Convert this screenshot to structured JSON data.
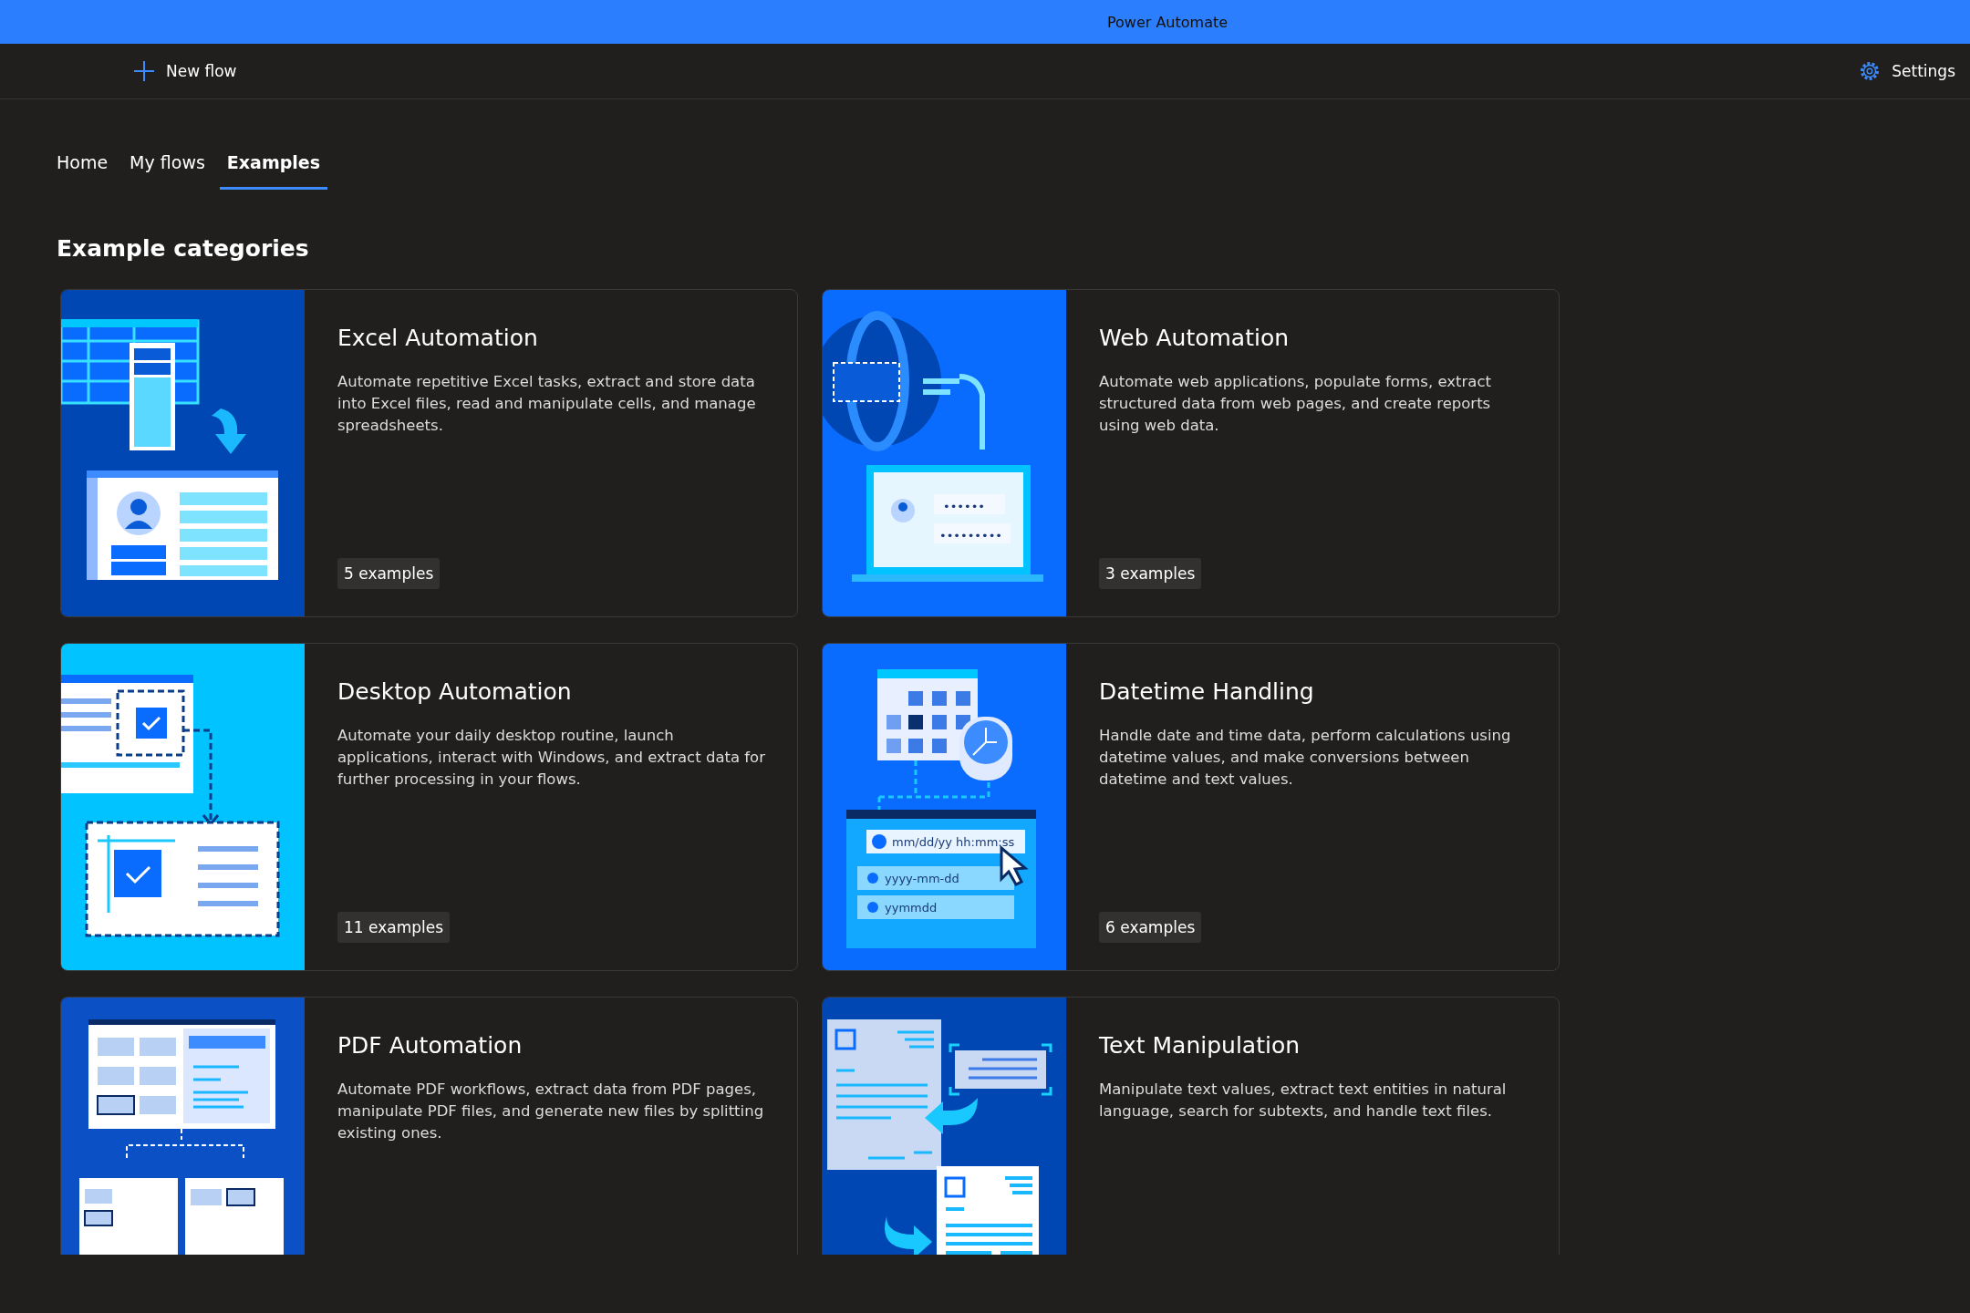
{
  "window": {
    "title": "Power Automate"
  },
  "toolbar": {
    "new_flow": "New flow",
    "settings": "Settings"
  },
  "tabs": [
    {
      "label": "Home",
      "selected": false
    },
    {
      "label": "My flows",
      "selected": false
    },
    {
      "label": "Examples",
      "selected": true
    }
  ],
  "heading": "Example categories",
  "cards": [
    {
      "kind": "spreadsheet",
      "title": "Excel Automation",
      "description": "Automate repetitive Excel tasks, extract and store data into Excel files, read and manipulate cells, and manage spreadsheets.",
      "count": "5 examples"
    },
    {
      "kind": "web",
      "title": "Web Automation",
      "description": "Automate web applications, populate forms, extract structured data from web pages, and create reports using web data.",
      "count": "3 examples",
      "illustration_texts": [
        "••••••",
        "•••••••••"
      ]
    },
    {
      "kind": "desktop",
      "title": "Desktop Automation",
      "description": "Automate your daily desktop routine, launch applications, interact with Windows, and extract data for further processing in your flows.",
      "count": "11 examples"
    },
    {
      "kind": "datetime",
      "title": "Datetime Handling",
      "description": "Handle date and time data, perform calculations using datetime values, and make conversions between datetime and text values.",
      "count": "6 examples",
      "illustration_texts": [
        "mm/dd/yy hh:mm:ss",
        "yyyy-mm-dd",
        "yymmdd"
      ]
    },
    {
      "kind": "pdf",
      "title": "PDF Automation",
      "description": "Automate PDF workflows, extract data from PDF pages, manipulate PDF files, and generate new files by splitting existing ones."
    },
    {
      "kind": "text",
      "title": "Text Manipulation",
      "description": "Manipulate text values, extract text entities in natural language, search for subtexts, and handle text files."
    }
  ]
}
